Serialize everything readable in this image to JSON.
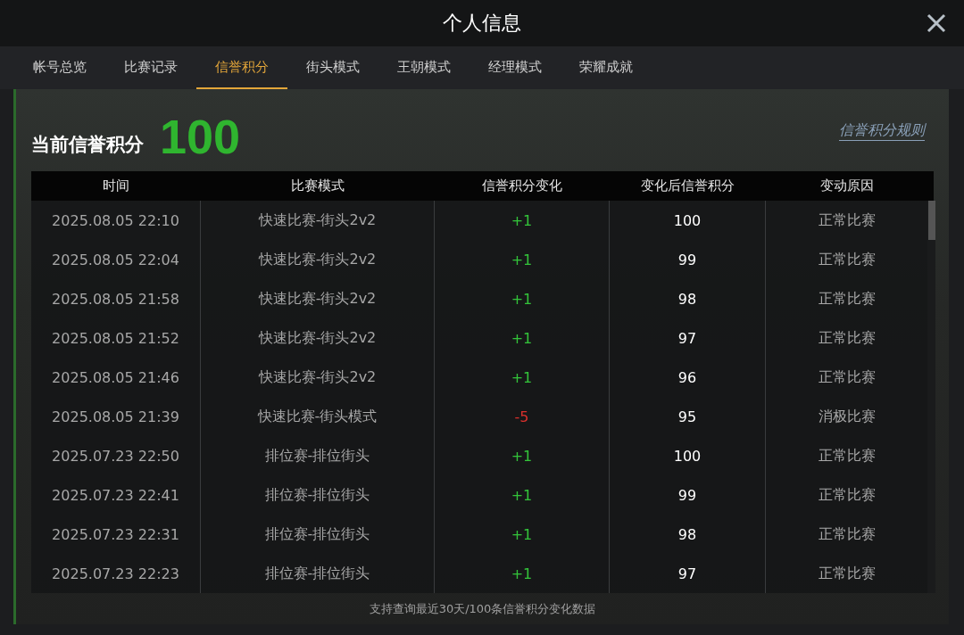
{
  "window": {
    "title": "个人信息"
  },
  "tabs": [
    {
      "label": "帐号总览",
      "selected": false
    },
    {
      "label": "比赛记录",
      "selected": false
    },
    {
      "label": "信誉积分",
      "selected": true
    },
    {
      "label": "街头模式",
      "selected": false
    },
    {
      "label": "王朝模式",
      "selected": false
    },
    {
      "label": "经理模式",
      "selected": false
    },
    {
      "label": "荣耀成就",
      "selected": false
    }
  ],
  "score": {
    "label": "当前信誉积分",
    "value": "100",
    "rules_link": "信誉积分规则"
  },
  "table": {
    "columns": [
      "时间",
      "比赛模式",
      "信誉积分变化",
      "变化后信誉积分",
      "变动原因"
    ],
    "rows": [
      {
        "time": "2025.08.05  22:10",
        "mode": "快速比赛-街头2v2",
        "change": "+1",
        "kind": "gain",
        "after": "100",
        "reason": "正常比赛"
      },
      {
        "time": "2025.08.05  22:04",
        "mode": "快速比赛-街头2v2",
        "change": "+1",
        "kind": "gain",
        "after": "99",
        "reason": "正常比赛"
      },
      {
        "time": "2025.08.05  21:58",
        "mode": "快速比赛-街头2v2",
        "change": "+1",
        "kind": "gain",
        "after": "98",
        "reason": "正常比赛"
      },
      {
        "time": "2025.08.05  21:52",
        "mode": "快速比赛-街头2v2",
        "change": "+1",
        "kind": "gain",
        "after": "97",
        "reason": "正常比赛"
      },
      {
        "time": "2025.08.05  21:46",
        "mode": "快速比赛-街头2v2",
        "change": "+1",
        "kind": "gain",
        "after": "96",
        "reason": "正常比赛"
      },
      {
        "time": "2025.08.05  21:39",
        "mode": "快速比赛-街头模式",
        "change": "-5",
        "kind": "loss",
        "after": "95",
        "reason": "消极比赛"
      },
      {
        "time": "2025.07.23  22:50",
        "mode": "排位赛-排位街头",
        "change": "+1",
        "kind": "gain",
        "after": "100",
        "reason": "正常比赛"
      },
      {
        "time": "2025.07.23  22:41",
        "mode": "排位赛-排位街头",
        "change": "+1",
        "kind": "gain",
        "after": "99",
        "reason": "正常比赛"
      },
      {
        "time": "2025.07.23  22:31",
        "mode": "排位赛-排位街头",
        "change": "+1",
        "kind": "gain",
        "after": "98",
        "reason": "正常比赛"
      },
      {
        "time": "2025.07.23  22:23",
        "mode": "排位赛-排位街头",
        "change": "+1",
        "kind": "gain",
        "after": "97",
        "reason": "正常比赛"
      }
    ]
  },
  "footer": "支持查询最近30天/100条信誉积分变化数据"
}
